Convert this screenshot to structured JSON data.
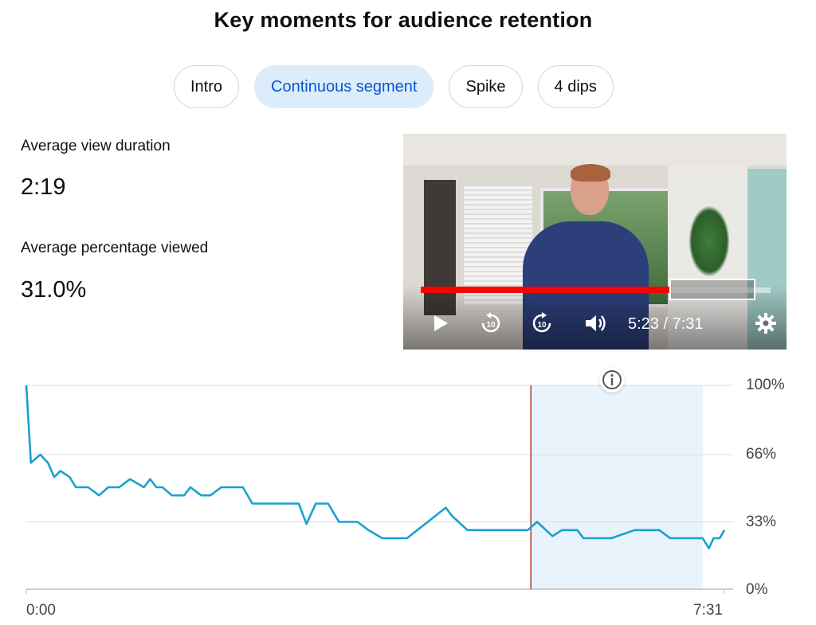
{
  "header": {
    "title": "Key moments for audience retention"
  },
  "tabs": [
    {
      "label": "Intro",
      "active": false
    },
    {
      "label": "Continuous segment",
      "active": true
    },
    {
      "label": "Spike",
      "active": false
    },
    {
      "label": "4 dips",
      "active": false
    }
  ],
  "stats": {
    "avg_view_duration": {
      "label": "Average view duration",
      "value": "2:19"
    },
    "avg_percentage_viewed": {
      "label": "Average percentage viewed",
      "value": "31.0%"
    }
  },
  "player": {
    "current_time": "5:23",
    "duration": "7:31",
    "time_display": "5:23 / 7:31",
    "progress_fraction": 0.716,
    "icons": [
      "play-icon",
      "rewind-10-icon",
      "forward-10-icon",
      "volume-icon",
      "settings-icon"
    ]
  },
  "colors": {
    "accent_line": "#1aa0d0",
    "highlight_fill": "#e8f3fb",
    "marker_line": "#b3261e",
    "active_chip_bg": "#dcecfa",
    "active_chip_text": "#0b57d0",
    "progress_red": "#ff0000"
  },
  "chart_data": {
    "type": "line",
    "x_unit": "seconds",
    "x_range": [
      0,
      451
    ],
    "x_tick_labels": [
      "0:00",
      "7:31"
    ],
    "y_range": [
      0,
      100
    ],
    "y_ticks": [
      0,
      33,
      66,
      100
    ],
    "y_tick_labels": [
      "0%",
      "33%",
      "66%",
      "100%"
    ],
    "grid": true,
    "legend": "none",
    "highlight_range": [
      326,
      437
    ],
    "marker_x": 326,
    "series": [
      {
        "x": [
          0,
          3,
          9,
          14,
          18,
          22,
          28,
          32,
          40,
          47,
          53,
          60,
          67,
          76,
          80,
          84,
          88,
          94,
          102,
          106,
          113,
          119,
          126,
          134,
          140,
          146,
          151,
          158,
          165,
          170,
          176,
          181,
          187,
          195,
          202,
          214,
          221,
          230,
          246,
          271,
          275,
          285,
          305,
          324,
          330,
          340,
          346,
          356,
          360,
          366,
          373,
          378,
          393,
          409,
          416,
          422,
          427,
          437,
          441,
          444,
          448,
          451
        ],
        "values": [
          100,
          62,
          66,
          62,
          55,
          58,
          55,
          50,
          50,
          46,
          50,
          50,
          54,
          50,
          54,
          50,
          50,
          46,
          46,
          50,
          46,
          46,
          50,
          50,
          50,
          42,
          42,
          42,
          42,
          42,
          42,
          32,
          42,
          42,
          33,
          33,
          29,
          25,
          25,
          40,
          36,
          29,
          29,
          29,
          33,
          26,
          29,
          29,
          25,
          25,
          25,
          25,
          29,
          29,
          25,
          25,
          25,
          25,
          20,
          25,
          25,
          29
        ]
      }
    ]
  }
}
